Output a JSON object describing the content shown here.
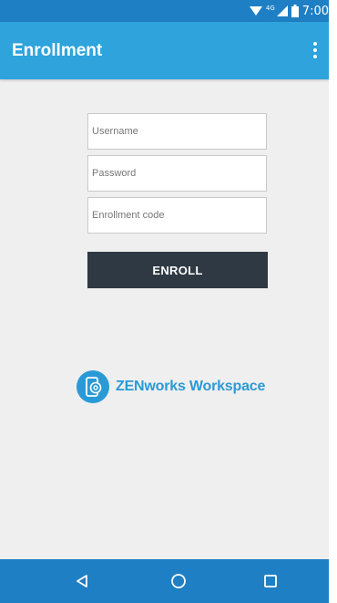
{
  "status_bar": {
    "time": "7:00",
    "network_type": "4G",
    "icons": [
      "wifi-icon",
      "cellular-signal-icon",
      "battery-icon"
    ]
  },
  "app_bar": {
    "title": "Enrollment",
    "menu_icon": "overflow-menu-icon"
  },
  "form": {
    "username": {
      "placeholder": "Username",
      "value": ""
    },
    "password": {
      "placeholder": "Password",
      "value": ""
    },
    "enrollment_code": {
      "placeholder": "Enrollment code",
      "value": ""
    },
    "enroll_label": "ENROLL"
  },
  "brand": {
    "name": "ZENworks Workspace",
    "logo_icon": "zenworks-logo-icon"
  },
  "nav_bar": {
    "icons": [
      "back-icon",
      "home-icon",
      "recents-icon"
    ]
  },
  "colors": {
    "status_bar": "#1e7fc4",
    "app_bar": "#2ea3dc",
    "background": "#efefef",
    "enroll_button": "#2f3943",
    "brand": "#2a9ad6",
    "nav_bar": "#1e7fc4"
  }
}
